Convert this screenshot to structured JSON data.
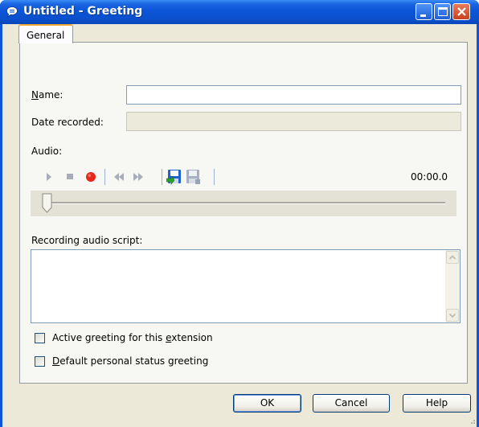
{
  "window": {
    "title": "Untitled - Greeting",
    "icon": "speech-bubble-icon"
  },
  "tabs": [
    {
      "label": "General",
      "selected": true
    }
  ],
  "form": {
    "name": {
      "label_accel": "N",
      "label_rest": "ame:",
      "value": ""
    },
    "date_recorded": {
      "label": "Date recorded:",
      "value": ""
    },
    "audio": {
      "label": "Audio:",
      "controls": [
        "play-icon",
        "stop-icon",
        "record-icon",
        "rewind-icon",
        "fast-forward-icon",
        "save-icon",
        "save-disabled-icon"
      ],
      "time": "00:00.0",
      "position": 0
    },
    "script": {
      "label": "Recording audio script:",
      "value": ""
    },
    "checkboxes": [
      {
        "pre": "Active greeting for this ",
        "accel": "e",
        "post": "xtension",
        "checked": false
      },
      {
        "pre": "",
        "accel": "D",
        "post": "efault personal status greeting",
        "checked": false
      }
    ]
  },
  "buttons": {
    "ok": "OK",
    "cancel": "Cancel",
    "help": "Help"
  },
  "colors": {
    "titlebar": "#0a55d8",
    "dialog_bg": "#ece9d8",
    "record": "#e8261a",
    "tab_accent": "#f3a935"
  }
}
